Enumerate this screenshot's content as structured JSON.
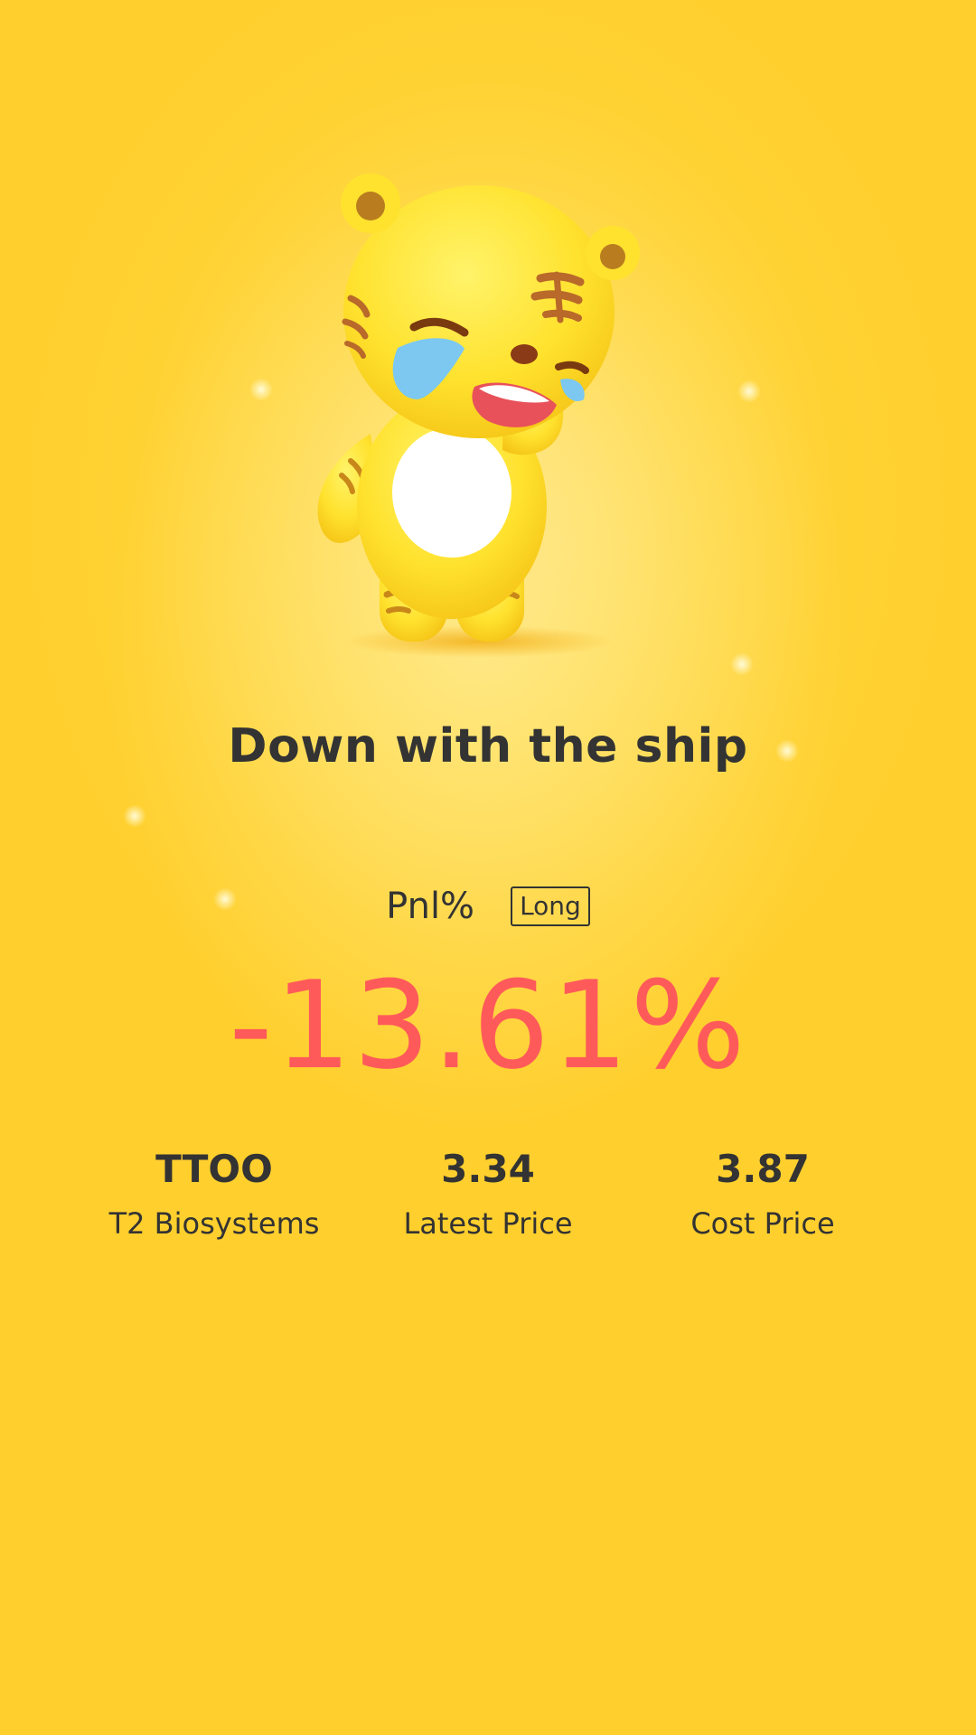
{
  "colors": {
    "background": "#ffd233",
    "text": "#333333",
    "loss": "#ff5a5a"
  },
  "mascot": {
    "icon": "crying-tiger-mascot"
  },
  "title": "Down with the ship",
  "pnl": {
    "label": "Pnl%",
    "position_badge": "Long",
    "value": "-13.61%"
  },
  "stats": {
    "ticker": "TTOO",
    "company": "T2 Biosystems",
    "latest_price": "3.34",
    "latest_price_label": "Latest Price",
    "cost_price": "3.87",
    "cost_price_label": "Cost Price"
  }
}
